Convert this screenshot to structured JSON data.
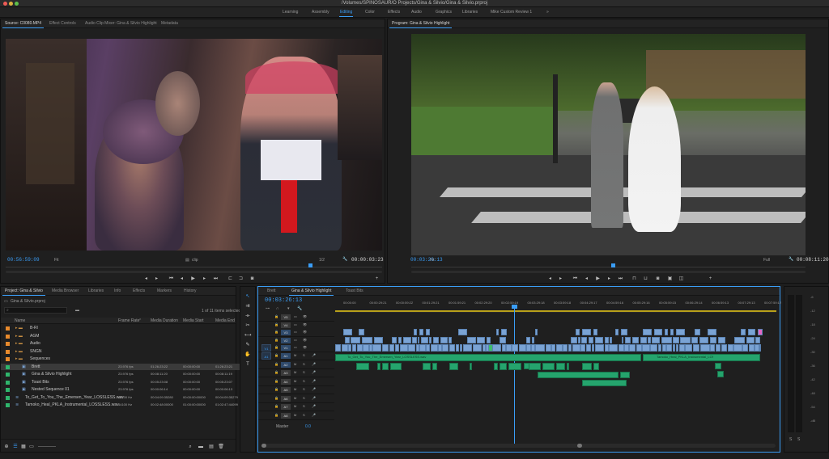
{
  "title": "/Volumes/SPINOSAUR/O Projects/Gina & Silvio/Gina & Silvio.prproj",
  "workspaces": [
    "Learning",
    "Assembly",
    "Editing",
    "Color",
    "Effects",
    "Audio",
    "Graphics",
    "Libraries",
    "Mike Custom Review 1"
  ],
  "workspaces_more": "»",
  "source_tabs": [
    "Source: C0080.MP4",
    "Effect Controls",
    "Audio Clip Mixer: Gina & Silvio Highlight",
    "Metadata"
  ],
  "program_tab": "Program: Gina & Silvio Highlight",
  "source": {
    "tc": "00:56:59:09",
    "fit": "Fit",
    "res": "1/2",
    "duration": "00:00:03:23"
  },
  "program": {
    "tc": "00:03:26:13",
    "fit": "Fit",
    "res": "Full",
    "duration": "00:08:11:20"
  },
  "project": {
    "tabs": [
      "Project: Gina & Silvio",
      "Media Browser",
      "Libraries",
      "Info",
      "Effects",
      "Markers",
      "History"
    ],
    "path": "Gina & Silvio.prproj",
    "count": "1 of 11 items selected",
    "columns": [
      "Name",
      "Frame Rate",
      "Media Duration",
      "Media Start",
      "Media End"
    ],
    "items": [
      {
        "name": "B-Rl",
        "kind": "folder",
        "color": "#e88a2c",
        "indent": 0
      },
      {
        "name": "AGM",
        "kind": "folder",
        "color": "#e88a2c",
        "indent": 0
      },
      {
        "name": "Audio",
        "kind": "folder",
        "color": "#e88a2c",
        "indent": 0
      },
      {
        "name": "SNGN",
        "kind": "folder",
        "color": "#e88a2c",
        "indent": 0
      },
      {
        "name": "Sequences",
        "kind": "folder",
        "color": "#e88a2c",
        "indent": 0
      },
      {
        "name": "Brett",
        "kind": "seq",
        "color": "#2fb56c",
        "indent": 1,
        "rate": "23.976 fps",
        "dur": "01:26:23:22",
        "start": "00:00:00:00",
        "end": "01:26:23:21"
      },
      {
        "name": "Gina & Silvio Highlight",
        "kind": "seq",
        "color": "#2fb56c",
        "indent": 1,
        "rate": "23.976 fps",
        "dur": "00:08:11:20",
        "start": "00:00:00:00",
        "end": "00:08:11:19"
      },
      {
        "name": "Toast Bits",
        "kind": "seq",
        "color": "#2fb56c",
        "indent": 1,
        "rate": "23.976 fps",
        "dur": "00:05:23:08",
        "start": "00:00:00:00",
        "end": "00:05:23:07"
      },
      {
        "name": "Nested Sequence 01",
        "kind": "seq",
        "color": "#2fb56c",
        "indent": 1,
        "rate": "23.976 fps",
        "dur": "00:00:06:14",
        "start": "00:00:00:00",
        "end": "00:00:06:13"
      },
      {
        "name": "To_Get_To_You_The_Emersen_Year_LOSSLESS.wav",
        "kind": "audio",
        "color": "#2fb56c",
        "indent": 0,
        "rate": "44100 Hz",
        "dur": "00:04:09:35280",
        "start": "00:00:00:00000",
        "end": "00:04:09:35279"
      },
      {
        "name": "Tamoko_Heal_PKLA_Instrumental_LOSSLESS.wav",
        "kind": "audio",
        "color": "#2fb56c",
        "indent": 0,
        "rate": "44100 Hz",
        "dur": "00:02:48:00000",
        "start": "01:00:00:00000",
        "end": "01:02:47:44099"
      }
    ]
  },
  "timeline": {
    "tabs": [
      "Brett",
      "Gina & Silvio Highlight",
      "Toast Bits"
    ],
    "tc": "00:03:26:13",
    "ruler": [
      "00:00:00",
      "00:00:29:21",
      "00:00:59:22",
      "00:01:29:21",
      "00:01:59:21",
      "00:02:29:20",
      "00:02:59:19",
      "00:03:29:18",
      "00:03:59:18",
      "00:04:29:17",
      "00:04:59:16",
      "00:05:29:16",
      "00:05:59:15",
      "00:06:29:14",
      "00:06:59:13",
      "00:07:29:13",
      "00:07:59:12"
    ],
    "video_tracks": [
      "V5",
      "V4",
      "V3",
      "V2",
      "V1"
    ],
    "audio_tracks": [
      "A1",
      "A2",
      "A3",
      "A4",
      "A5",
      "A6",
      "A7",
      "A8"
    ],
    "master": "Master",
    "master_val": "0.0",
    "audio_clip_labels": [
      "To_Get_To_You_The_Emersen_Year_LOSSLESS.wav",
      "Tamoko_Heal_PKLA_Instrumental_LOSSLESS"
    ]
  },
  "meter": {
    "labels": [
      "-6",
      "-12",
      "-18",
      "-24",
      "-30",
      "-36",
      "-42",
      "-48",
      "-54",
      "-dB"
    ],
    "ch": [
      "S",
      "S"
    ]
  }
}
